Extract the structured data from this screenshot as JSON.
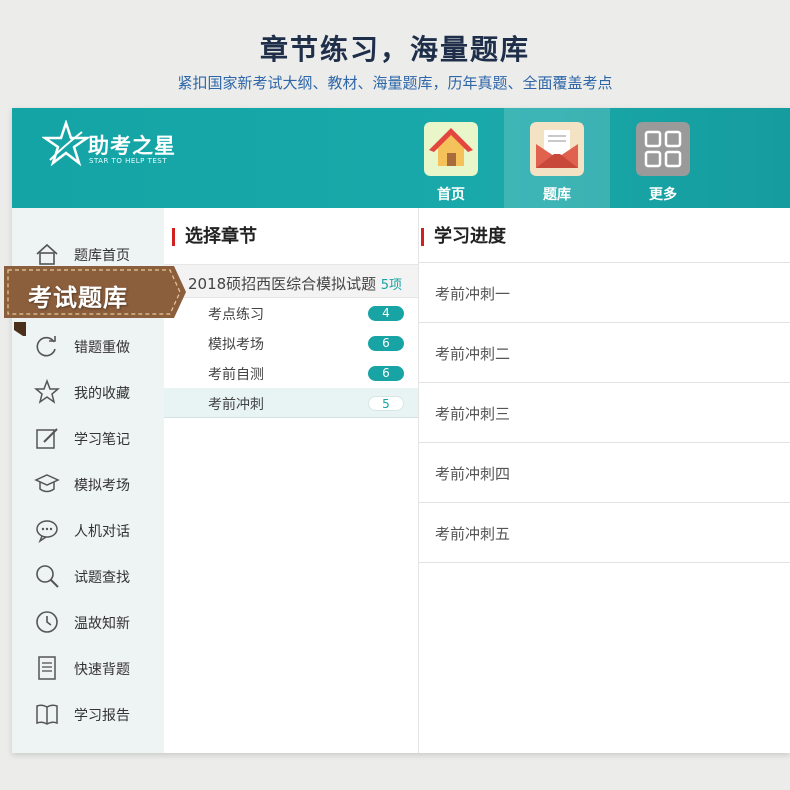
{
  "header": {
    "title": "章节练习，海量题库",
    "subtitle": "紧扣国家新考试大纲、教材、海量题库，历年真题、全面覆盖考点"
  },
  "logo": {
    "title": "助考之星",
    "subtitle": "STAR TO HELP TEST"
  },
  "nav": [
    {
      "label": "首页",
      "icon": "home-icon"
    },
    {
      "label": "题库",
      "icon": "envelope-icon"
    },
    {
      "label": "更多",
      "icon": "grid-icon"
    }
  ],
  "ribbon": {
    "label": "考试题库"
  },
  "sidebar": {
    "items": [
      {
        "label": "题库首页",
        "icon": "home-outline-icon"
      },
      {
        "label": "错题重做",
        "icon": "refresh-icon"
      },
      {
        "label": "我的收藏",
        "icon": "star-icon"
      },
      {
        "label": "学习笔记",
        "icon": "edit-icon"
      },
      {
        "label": "模拟考场",
        "icon": "graduation-cap-icon"
      },
      {
        "label": "人机对话",
        "icon": "chat-icon"
      },
      {
        "label": "试题查找",
        "icon": "search-icon"
      },
      {
        "label": "温故知新",
        "icon": "clock-icon"
      },
      {
        "label": "快速背题",
        "icon": "document-icon"
      },
      {
        "label": "学习报告",
        "icon": "book-icon"
      }
    ]
  },
  "chapters": {
    "heading": "选择章节",
    "root": {
      "label": "2018硕招西医综合模拟试题",
      "count": "5项"
    },
    "items": [
      {
        "label": "考点练习",
        "count": "4"
      },
      {
        "label": "模拟考场",
        "count": "6"
      },
      {
        "label": "考前自测",
        "count": "6"
      },
      {
        "label": "考前冲刺",
        "count": "5"
      }
    ]
  },
  "progress": {
    "heading": "学习进度",
    "items": [
      "考前冲刺一",
      "考前冲刺二",
      "考前冲刺三",
      "考前冲刺四",
      "考前冲刺五"
    ]
  },
  "colors": {
    "accent": "#18a3a4",
    "red_marker": "#d12020",
    "ribbon": "#8b5e3c"
  }
}
